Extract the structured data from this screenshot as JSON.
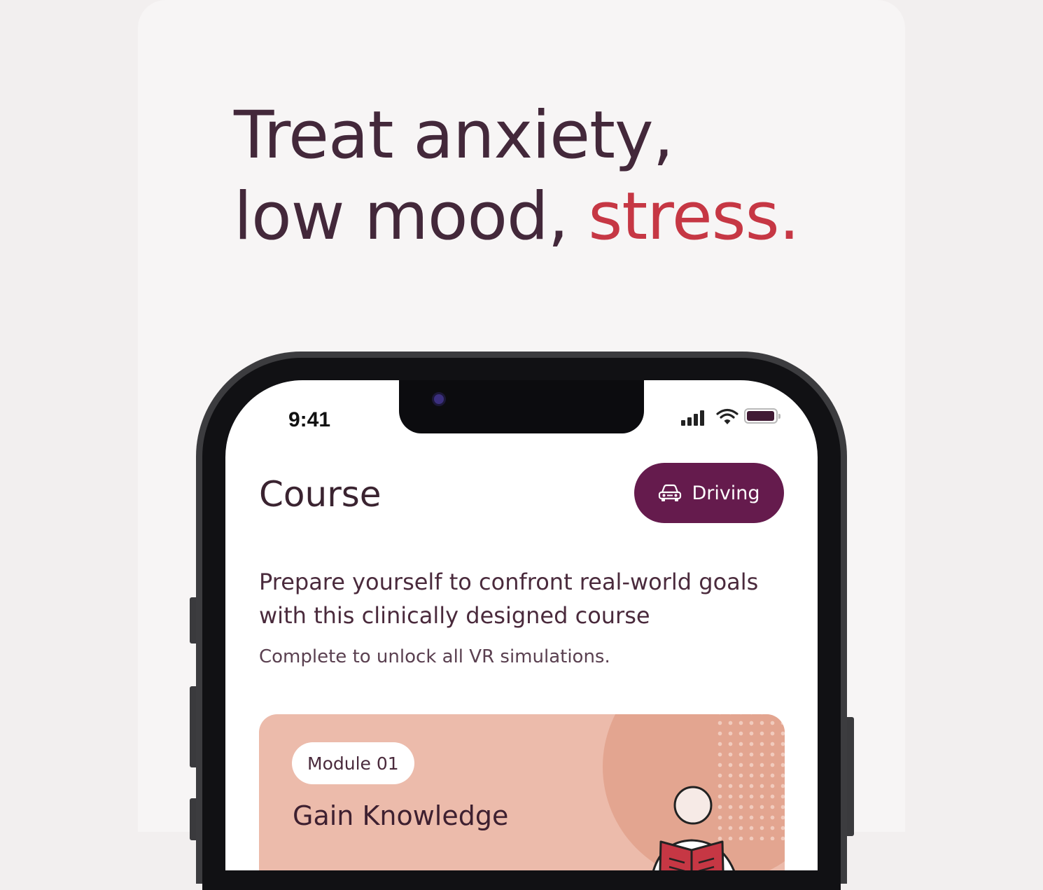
{
  "headline": {
    "line1": "Treat anxiety,",
    "line2_prefix": "low mood, ",
    "line2_accent": "stress."
  },
  "colors": {
    "headline": "#43283a",
    "accent": "#c63744",
    "chip_bg": "#651b4d",
    "module_card_bg": "#ecbbab"
  },
  "status_bar": {
    "time": "9:41",
    "icons": [
      "cellular-signal-icon",
      "wifi-icon",
      "battery-icon"
    ]
  },
  "app": {
    "page_title": "Course",
    "filter_chip": {
      "icon": "car-icon",
      "label": "Driving"
    },
    "description": "Prepare yourself to confront real-world goals with this clinically designed course",
    "subnote": "Complete to unlock all VR simulations.",
    "module": {
      "badge": "Module 01",
      "title": "Gain Knowledge",
      "illustration": "person-reading-book-illustration"
    }
  }
}
